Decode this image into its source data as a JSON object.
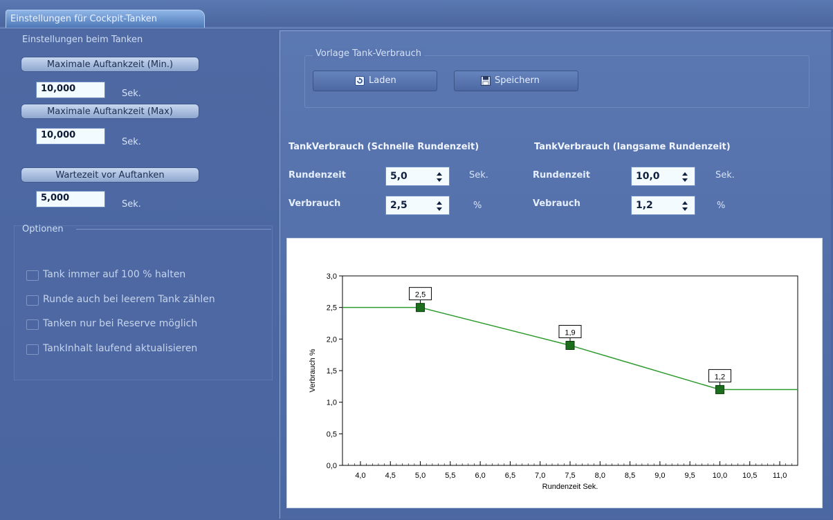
{
  "tab": {
    "title": "Einstellungen für Cockpit-Tanken"
  },
  "left": {
    "section_title": "Einstellungen beim Tanken",
    "fields": [
      {
        "label": "Maximale Auftankzeit (Min.)",
        "value": "10,000",
        "unit": "Sek."
      },
      {
        "label": "Maximale Auftankzeit (Max)",
        "value": "10,000",
        "unit": "Sek."
      },
      {
        "label": "Wartezeit vor Auftanken",
        "value": "5,000",
        "unit": "Sek."
      }
    ],
    "options_title": "Optionen",
    "options": [
      {
        "label": "Tank immer auf 100 % halten",
        "checked": false
      },
      {
        "label": "Runde auch bei leerem Tank zählen",
        "checked": false
      },
      {
        "label": "Tanken nur bei Reserve möglich",
        "checked": false
      },
      {
        "label": "TankInhalt laufend aktualisieren",
        "checked": false
      }
    ]
  },
  "template": {
    "title": "Vorlage Tank-Verbrauch",
    "load_label": "Laden",
    "save_label": "Speichern"
  },
  "fast": {
    "header": "TankVerbrauch (Schnelle Rundenzeit)",
    "laptime_label": "Rundenzeit",
    "laptime_value": "5,0",
    "laptime_unit": "Sek.",
    "consumption_label": "Verbrauch",
    "consumption_value": "2,5",
    "consumption_unit": "%"
  },
  "slow": {
    "header": "TankVerbrauch (langsame Rundenzeit)",
    "laptime_label": "Rundenzeit",
    "laptime_value": "10,0",
    "laptime_unit": "Sek.",
    "consumption_label": "Vebrauch",
    "consumption_value": "1,2",
    "consumption_unit": "%"
  },
  "chart_data": {
    "type": "line",
    "xlabel": "Rundenzeit Sek.",
    "ylabel": "Verbrauch %",
    "xlim": [
      3.7,
      11.3
    ],
    "ylim": [
      0.0,
      3.0
    ],
    "x_ticks": [
      "4,0",
      "4,5",
      "5,0",
      "5,5",
      "6,0",
      "6,5",
      "7,0",
      "7,5",
      "8,0",
      "8,5",
      "9,0",
      "9,5",
      "10,0",
      "10,5",
      "11,0"
    ],
    "y_ticks": [
      "0,0",
      "0,5",
      "1,0",
      "1,5",
      "2,0",
      "2,5",
      "3,0"
    ],
    "line": {
      "x": [
        3.7,
        5.0,
        7.5,
        10.0,
        11.3
      ],
      "y": [
        2.5,
        2.5,
        1.9,
        1.2,
        1.2
      ]
    },
    "points": [
      {
        "x": 5.0,
        "y": 2.5,
        "label": "2,5"
      },
      {
        "x": 7.5,
        "y": 1.9,
        "label": "1,9"
      },
      {
        "x": 10.0,
        "y": 1.2,
        "label": "1,2"
      }
    ],
    "line_color": "#2e9a2e",
    "marker_color": "#1c6e1c",
    "grid": false
  }
}
